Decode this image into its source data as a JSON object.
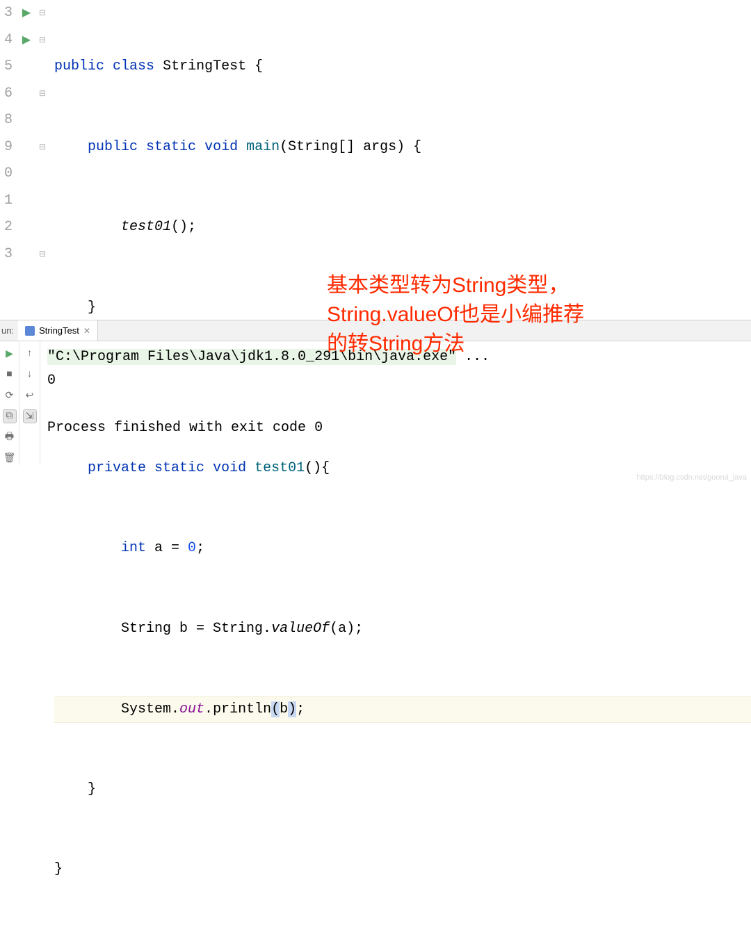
{
  "editor": {
    "line_numbers": [
      "3",
      "4",
      "5",
      "6",
      "",
      "8",
      "9",
      "0",
      "1",
      "2",
      "3"
    ],
    "code": {
      "l3": {
        "kw1": "public",
        "kw2": "class",
        "name": "StringTest",
        "brace": " {"
      },
      "l4": {
        "kw1": "public",
        "kw2": "static",
        "kw3": "void",
        "name": "main",
        "params": "(String[] args)",
        "brace": " {"
      },
      "l5": {
        "call": "test01",
        "rest": "();"
      },
      "l6": {
        "brace": "}"
      },
      "l8": {
        "kw1": "private",
        "kw2": "static",
        "kw3": "void",
        "name": "test01",
        "params": "()",
        "brace": "{"
      },
      "l9": {
        "kw1": "int",
        "var": " a = ",
        "num": "0",
        "semi": ";"
      },
      "l10": {
        "pre": "String b = String.",
        "call": "valueOf",
        "post": "(a);"
      },
      "l11": {
        "pre": "System.",
        "field": "out",
        "dot": ".",
        "call": "println",
        "lp": "(",
        "arg": "b",
        "rp": ")",
        "semi": ";"
      },
      "l12": {
        "brace": "}"
      },
      "l13": {
        "brace": "}"
      }
    }
  },
  "run": {
    "label": "un:",
    "tab": "StringTest",
    "console": {
      "cmd": "\"C:\\Program Files\\Java\\jdk1.8.0_291\\bin\\java.exe\"",
      "cmd_suffix": " ...",
      "output": "0",
      "exit": "Process finished with exit code 0"
    }
  },
  "annotation": {
    "line1": "基本类型转为String类型，",
    "line2": "String.valueOf也是小编推荐",
    "line3": "的转String方法"
  },
  "watermark": "https://blog.csdn.net/guorui_java"
}
